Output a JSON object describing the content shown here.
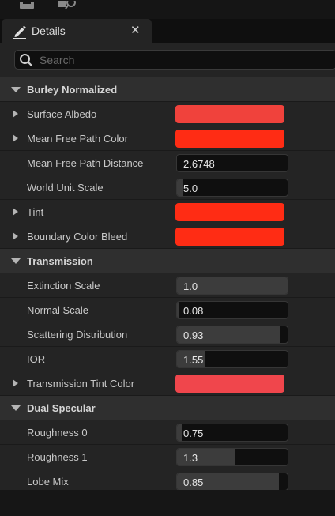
{
  "tab": {
    "title": "Details",
    "close_glyph": "✕"
  },
  "search": {
    "placeholder": "Search"
  },
  "sections": [
    {
      "title": "Burley Normalized",
      "expanded": true,
      "properties": [
        {
          "label": "Surface Albedo",
          "type": "color",
          "color": "#f0423c",
          "expandable": true
        },
        {
          "label": "Mean Free Path Color",
          "type": "color",
          "color": "#ff2c14",
          "expandable": true
        },
        {
          "label": "Mean Free Path Distance",
          "type": "number",
          "value": "2.6748",
          "fill": 0.0
        },
        {
          "label": "World Unit Scale",
          "type": "number",
          "value": "5.0",
          "fill": 0.05
        },
        {
          "label": "Tint",
          "type": "color",
          "color": "#ff2c14",
          "expandable": true
        },
        {
          "label": "Boundary Color Bleed",
          "type": "color",
          "color": "#ff2c14",
          "expandable": true
        }
      ]
    },
    {
      "title": "Transmission",
      "expanded": true,
      "properties": [
        {
          "label": "Extinction Scale",
          "type": "number",
          "value": "1.0",
          "fill": 1.0
        },
        {
          "label": "Normal Scale",
          "type": "number",
          "value": "0.08",
          "fill": 0.02
        },
        {
          "label": "Scattering Distribution",
          "type": "number",
          "value": "0.93",
          "fill": 0.93
        },
        {
          "label": "IOR",
          "type": "number",
          "value": "1.55",
          "fill": 0.26
        },
        {
          "label": "Transmission Tint Color",
          "type": "color",
          "color": "#f0464c",
          "expandable": true
        }
      ]
    },
    {
      "title": "Dual Specular",
      "expanded": true,
      "properties": [
        {
          "label": "Roughness 0",
          "type": "number",
          "value": "0.75",
          "fill": 0.04
        },
        {
          "label": "Roughness 1",
          "type": "number",
          "value": "1.3",
          "fill": 0.52
        },
        {
          "label": "Lobe Mix",
          "type": "number",
          "value": "0.85",
          "fill": 0.92
        }
      ]
    }
  ]
}
